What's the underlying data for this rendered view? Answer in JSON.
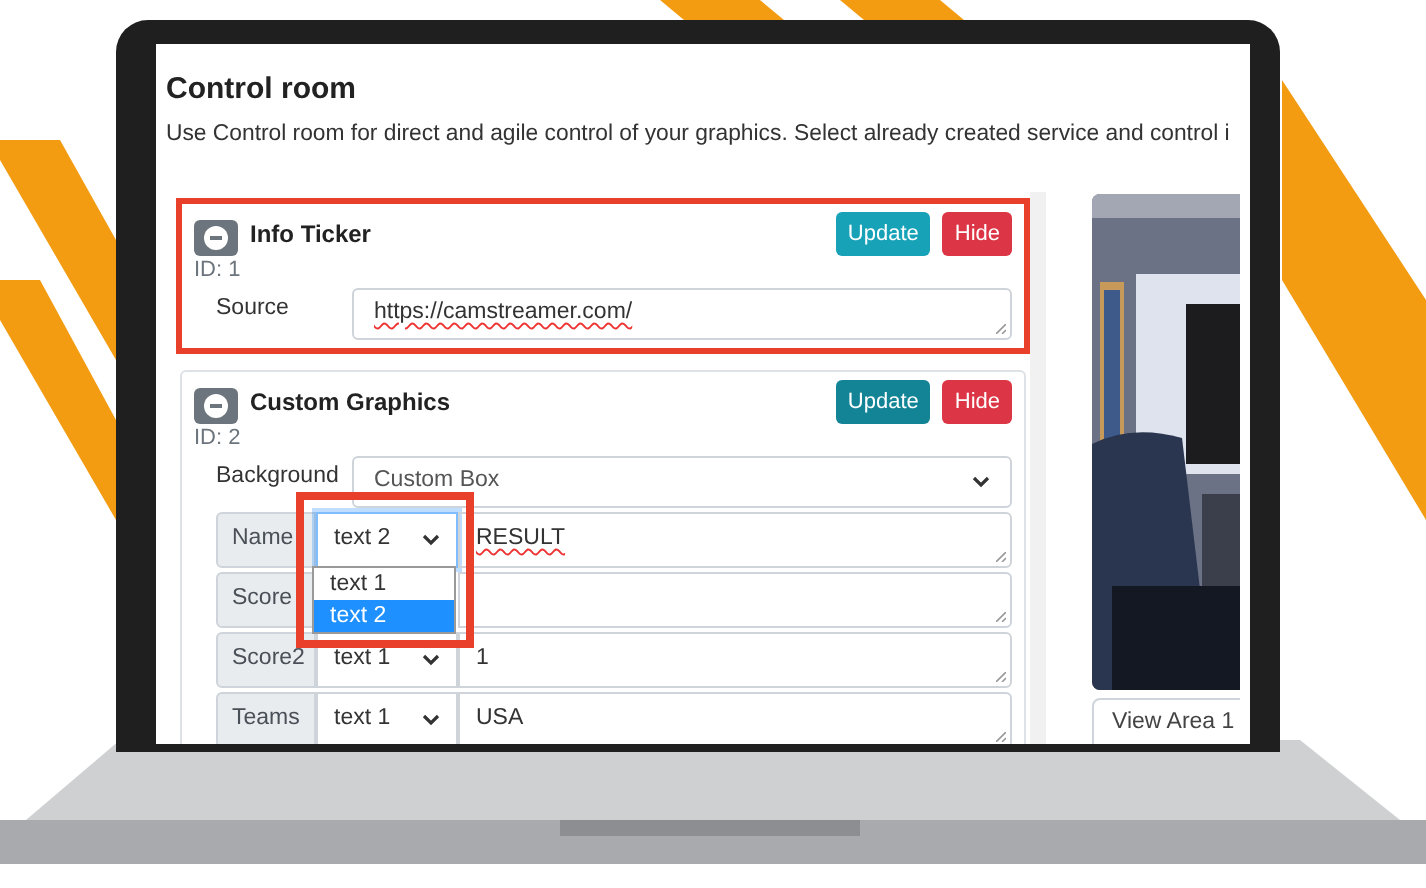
{
  "title": "Control room",
  "description": "Use Control room for direct and agile control of your graphics. Select already created service and control i",
  "services": [
    {
      "name": "Info Ticker",
      "id": "ID: 1",
      "highlighted": true,
      "buttons": [
        {
          "label": "Update",
          "kind": "update"
        },
        {
          "label": "Hide",
          "kind": "hide"
        }
      ],
      "fields": [
        {
          "kind": "textarea",
          "label": "Source",
          "value": "https://camstreamer.com/"
        }
      ]
    },
    {
      "name": "Custom Graphics",
      "id": "ID: 2",
      "highlighted": false,
      "buttons": [
        {
          "label": "Update",
          "kind": "update"
        },
        {
          "label": "Hide",
          "kind": "hide"
        }
      ],
      "fields": [
        {
          "kind": "select",
          "label": "Background",
          "value": "Custom Box"
        },
        {
          "kind": "group",
          "label": "Name",
          "select": "text 2",
          "value": "RESULT",
          "highlighted": true,
          "options": [
            {
              "label": "text 1",
              "selected": false
            },
            {
              "label": "text 2",
              "selected": true
            }
          ]
        },
        {
          "kind": "group",
          "label": "Score",
          "highlighted": false
        },
        {
          "kind": "group",
          "label": "Score2",
          "select": "text 1",
          "value": "1",
          "highlighted": false
        },
        {
          "kind": "group",
          "label": "Teams",
          "select": "text 1",
          "value": "USA",
          "highlighted": false
        }
      ]
    }
  ],
  "preview": {
    "kind": "picture",
    "button": "View Area 1"
  }
}
